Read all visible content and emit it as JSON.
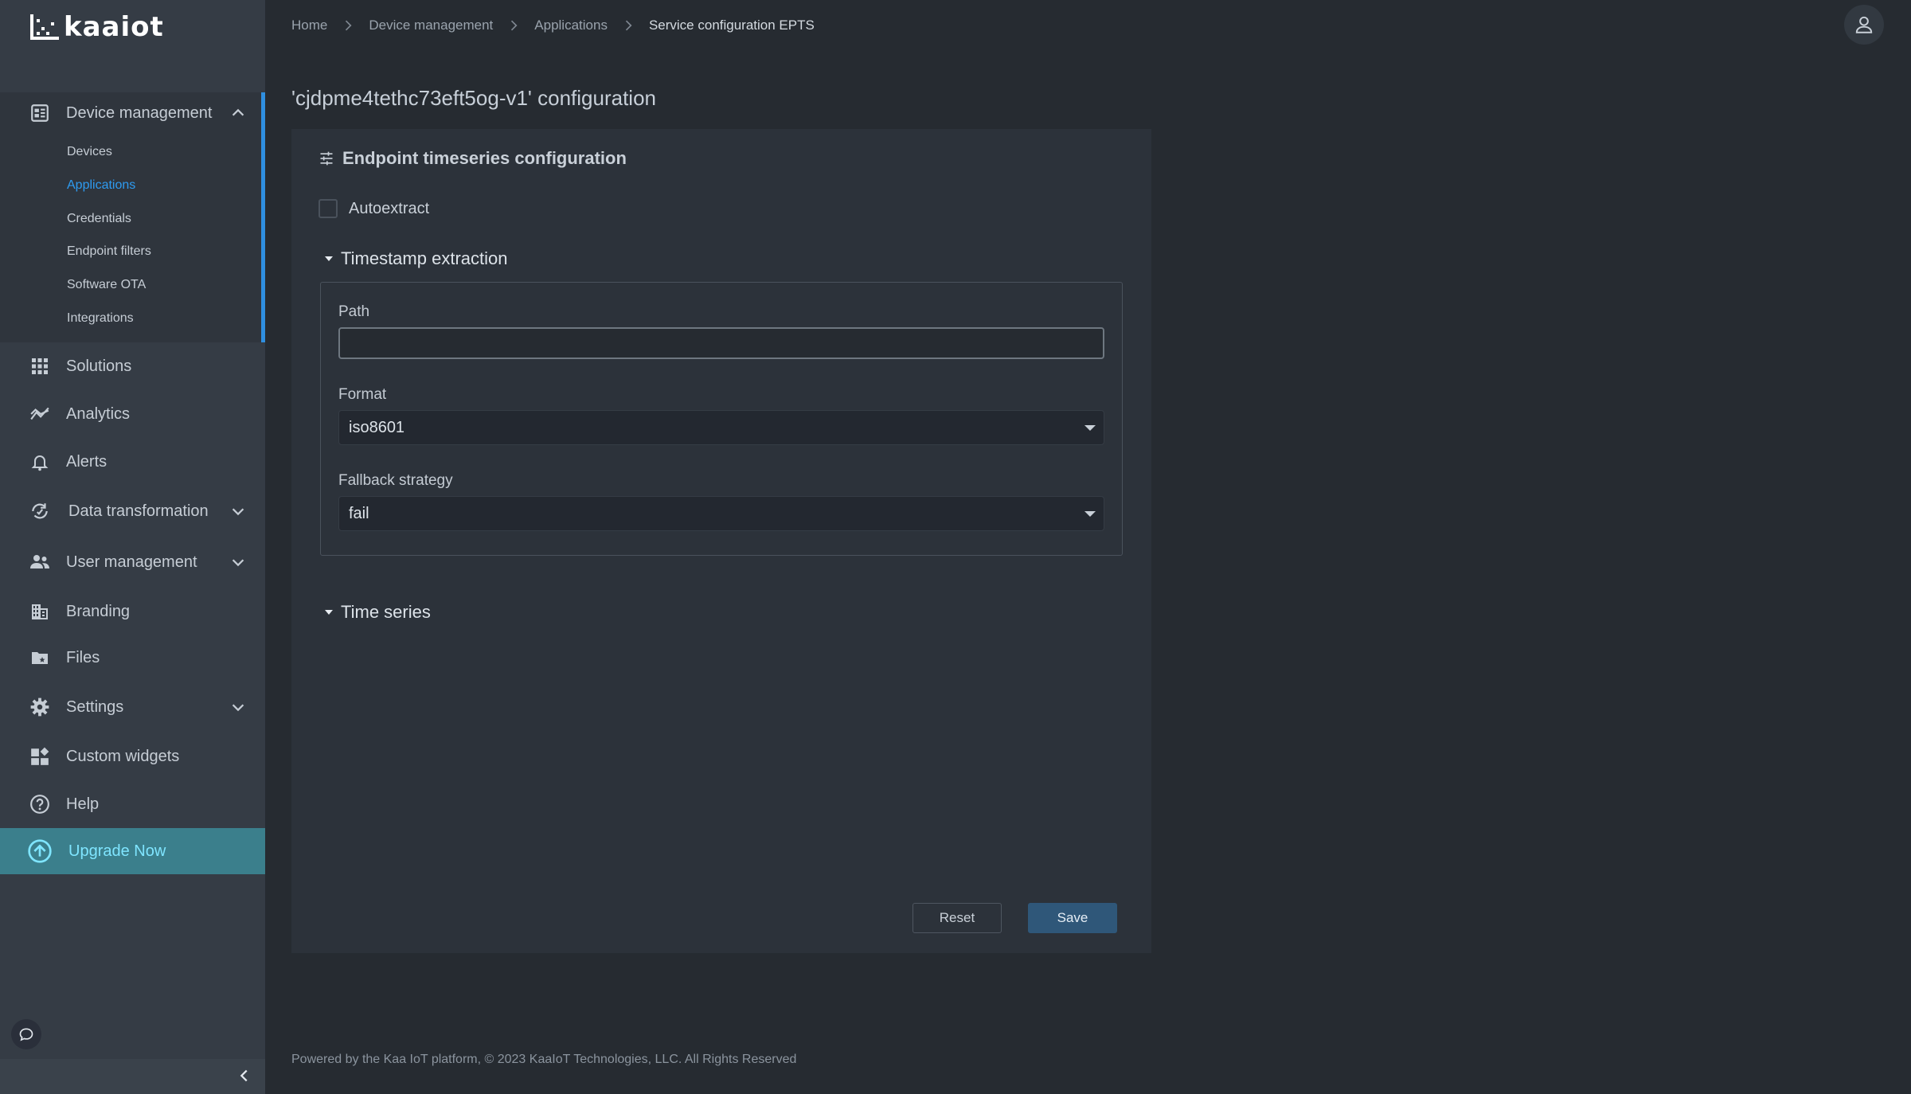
{
  "brand": {
    "logo_text": "kaaiot"
  },
  "sidebar": {
    "device_management": {
      "label": "Device management",
      "items": [
        {
          "label": "Devices",
          "active": false
        },
        {
          "label": "Applications",
          "active": true
        },
        {
          "label": "Credentials",
          "active": false
        },
        {
          "label": "Endpoint filters",
          "active": false
        },
        {
          "label": "Software OTA",
          "active": false
        },
        {
          "label": "Integrations",
          "active": false
        }
      ]
    },
    "items": [
      {
        "label": "Solutions",
        "icon": "grid-icon"
      },
      {
        "label": "Analytics",
        "icon": "analytics-icon"
      },
      {
        "label": "Alerts",
        "icon": "bell-icon"
      },
      {
        "label": "Data transformation",
        "icon": "data-transform-icon"
      },
      {
        "label": "User management",
        "icon": "users-icon"
      },
      {
        "label": "Branding",
        "icon": "building-icon"
      },
      {
        "label": "Files",
        "icon": "folder-icon"
      },
      {
        "label": "Settings",
        "icon": "gear-icon"
      },
      {
        "label": "Custom widgets",
        "icon": "widgets-icon"
      },
      {
        "label": "Help",
        "icon": "help-icon"
      }
    ],
    "upgrade_label": "Upgrade Now"
  },
  "breadcrumb": {
    "items": [
      "Home",
      "Device management",
      "Applications"
    ],
    "current": "Service configuration EPTS"
  },
  "main": {
    "page_title": "'cjdpme4tethc73eft5og-v1' configuration",
    "card_title": "Endpoint timeseries configuration",
    "autoextract_label": "Autoextract",
    "autoextract_checked": false,
    "timestamp_section": "Timestamp extraction",
    "path_label": "Path",
    "path_value": "",
    "format_label": "Format",
    "format_value": "iso8601",
    "fallback_label": "Fallback strategy",
    "fallback_value": "fail",
    "timeseries_section": "Time series",
    "reset_label": "Reset",
    "save_label": "Save"
  },
  "footer": "Powered by the Kaa IoT platform, © 2023 KaaIoT Technologies, LLC. All Rights Reserved",
  "colors": {
    "background": "#262b31",
    "sidebar": "#353c45",
    "accent": "#2e9bf0",
    "upgrade": "#3b7f8c",
    "save_button": "#2f5779"
  }
}
